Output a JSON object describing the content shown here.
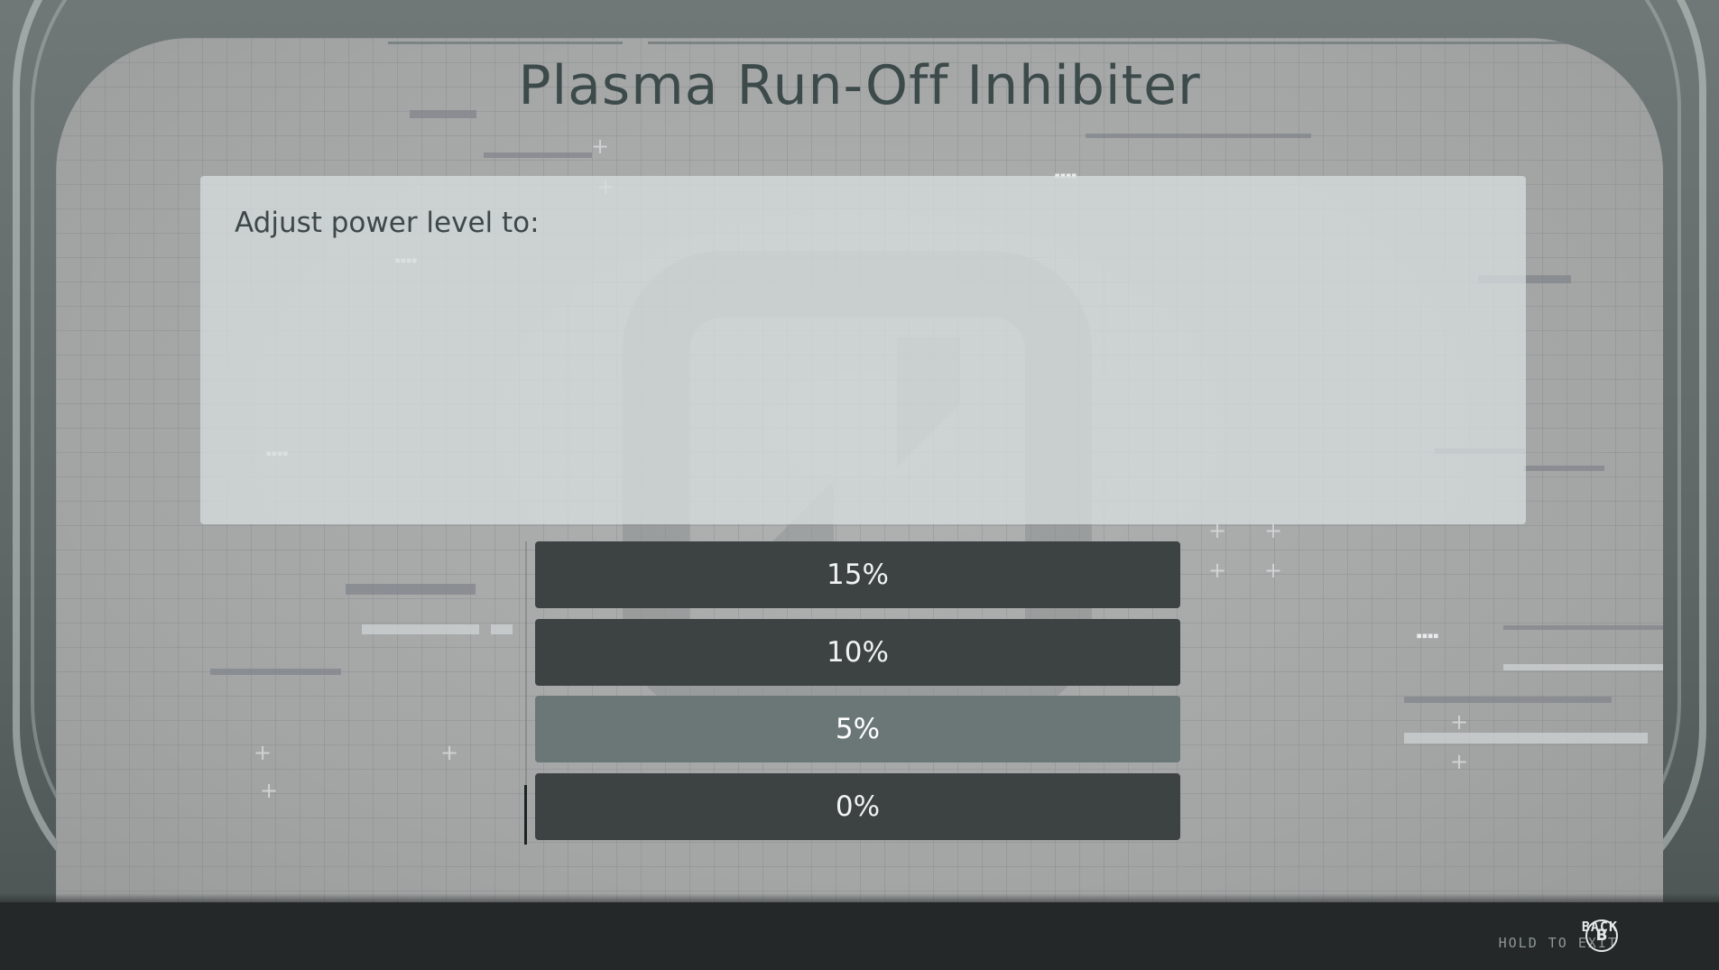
{
  "screen": {
    "title": "Plasma Run-Off Inhibiter"
  },
  "prompt": {
    "text": "Adjust power level to:"
  },
  "options": [
    {
      "label": "15%",
      "selected": false
    },
    {
      "label": "10%",
      "selected": false
    },
    {
      "label": "5%",
      "selected": true
    },
    {
      "label": "0%",
      "selected": false
    }
  ],
  "controls": {
    "back_label": "BACK",
    "hold_label": "HOLD TO EXIT",
    "back_button_glyph": "B"
  },
  "colors": {
    "option_default": "#3d4242",
    "option_selected": "#6b7777",
    "title_text": "#3d4a4a"
  }
}
